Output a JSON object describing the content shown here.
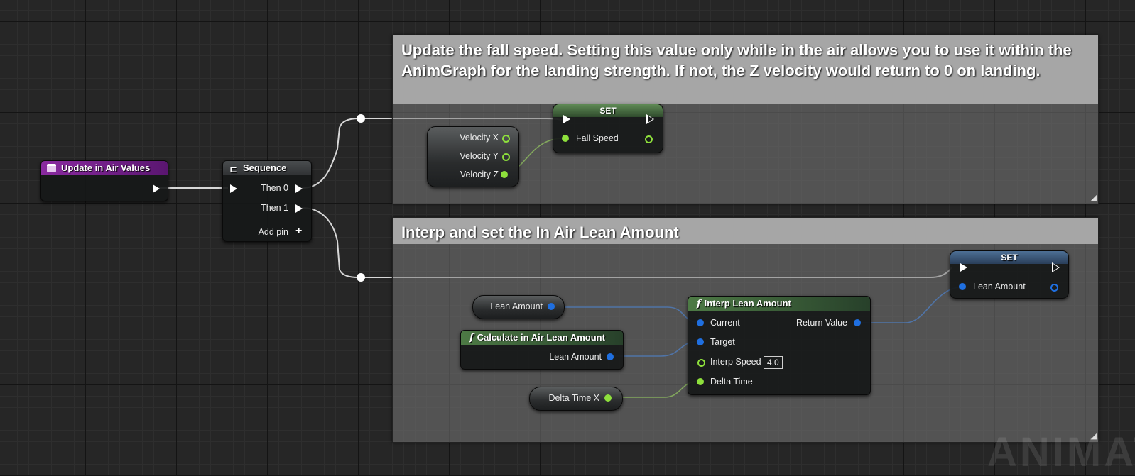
{
  "comments": {
    "fall_speed": "Update the fall speed. Setting this value only while in the air allows you to use it within the AnimGraph for the landing strength. If not, the Z velocity would return to 0 on landing.",
    "lean_amount": "Interp and set the In Air Lean Amount"
  },
  "event_node": {
    "title": "Update in Air Values"
  },
  "sequence_node": {
    "title": "Sequence",
    "then0": "Then 0",
    "then1": "Then 1",
    "add_pin": "Add pin"
  },
  "velocity_node": {
    "x": "Velocity X",
    "y": "Velocity Y",
    "z": "Velocity Z"
  },
  "set_fall_speed": {
    "title": "SET",
    "pin": "Fall Speed"
  },
  "set_lean": {
    "title": "SET",
    "pin": "Lean Amount"
  },
  "lean_amount_var": {
    "label": "Lean Amount"
  },
  "calc_node": {
    "title": "Calculate in Air Lean Amount",
    "output": "Lean Amount"
  },
  "delta_time_var": {
    "label": "Delta Time X"
  },
  "interp_node": {
    "title": "Interp Lean Amount",
    "current": "Current",
    "target": "Target",
    "interp_speed": "Interp Speed",
    "interp_speed_value": "4.0",
    "delta_time": "Delta Time",
    "return_value": "Return Value"
  },
  "watermark": "ANIMAT",
  "colors": {
    "exec": "#ffffff",
    "float_pin": "#8ee03c",
    "struct_pin": "#1f6fe0",
    "event_header": "#7a1f8f",
    "set_header_green": "#3f6b3a",
    "set_header_blue": "#2f4f78"
  },
  "icons": {
    "event": "event-icon",
    "sequence": "sequence-icon",
    "function": "function-icon",
    "add": "plus-icon",
    "resize": "resize-grip-icon"
  }
}
